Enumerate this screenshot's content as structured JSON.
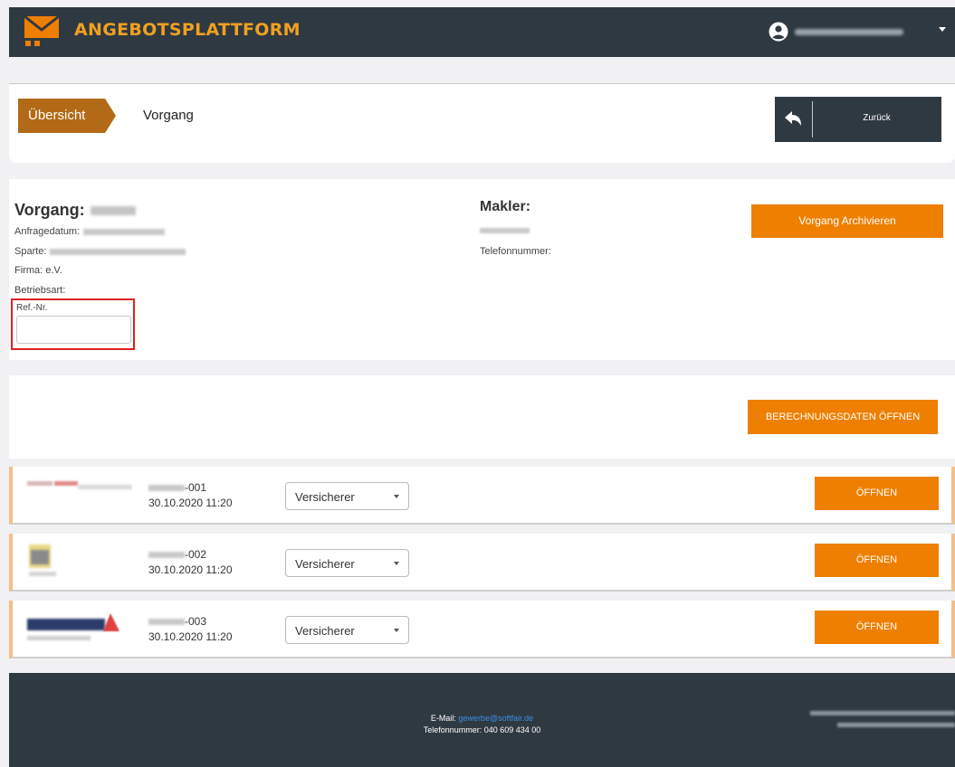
{
  "header": {
    "app_title": "ANGEBOTSPLATTFORM",
    "user_menu": "user-account-dropdown"
  },
  "breadcrumb": {
    "items": [
      "Übersicht",
      "Vorgang"
    ],
    "back_label": "Zurück"
  },
  "vorgang": {
    "heading": "Vorgang:",
    "anfragedatum_label": "Anfragedatum:",
    "sparte_label": "Sparte:",
    "firma_label": "Firma: e.V.",
    "betriebsart_label": "Betriebsart:",
    "ref_label": "Ref.-Nr.",
    "ref_value": ""
  },
  "makler": {
    "heading": "Makler:",
    "telefon_label": "Telefonnummer:"
  },
  "actions": {
    "archive_label": "Vorgang Archivieren",
    "calc_label": "BERECHNUNGSDATEN ÖFFNEN"
  },
  "offers": [
    {
      "id_suffix": "-001",
      "datetime": "30.10.2020 11:20",
      "select_value": "Versicherer",
      "open_label": "ÖFFNEN"
    },
    {
      "id_suffix": "-002",
      "datetime": "30.10.2020 11:20",
      "select_value": "Versicherer",
      "open_label": "ÖFFNEN"
    },
    {
      "id_suffix": "-003",
      "datetime": "30.10.2020 11:20",
      "select_value": "Versicherer",
      "open_label": "ÖFFNEN"
    }
  ],
  "footer": {
    "email_label": "E-Mail:",
    "email": "gewerbe@softfair.de",
    "phone": "Telefonnummer: 040 609 434 00"
  },
  "colors": {
    "primary": "#ee7f00",
    "breadcrumb": "#b26a16",
    "dark": "#2f3942",
    "highlight": "#e02020"
  },
  "icons": {
    "logo": "envelope-logo-icon",
    "user": "user-circle-icon",
    "back": "reply-arrow-icon"
  }
}
